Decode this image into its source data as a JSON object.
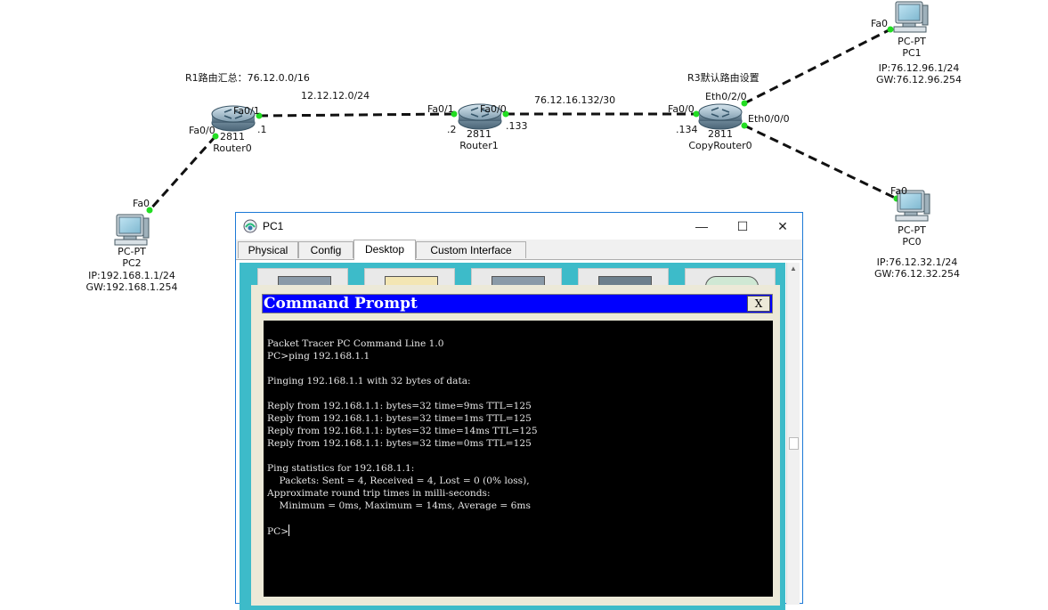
{
  "topology": {
    "devices": [
      {
        "id": "router0",
        "model": "2811",
        "name": "Router0"
      },
      {
        "id": "router1",
        "model": "2811",
        "name": "Router1"
      },
      {
        "id": "copyrouter0",
        "model": "2811",
        "name": "CopyRouter0"
      },
      {
        "id": "pc2",
        "type": "PC-PT",
        "name": "PC2",
        "ip": "IP:192.168.1.1/24",
        "gw": "GW:192.168.1.254"
      },
      {
        "id": "pc1",
        "type": "PC-PT",
        "name": "PC1",
        "ip": "IP:76.12.96.1/24",
        "gw": "GW:76.12.96.254"
      },
      {
        "id": "pc0",
        "type": "PC-PT",
        "name": "PC0",
        "ip": "IP:76.12.32.1/24",
        "gw": "GW:76.12.32.254"
      }
    ],
    "notes": {
      "r1_summary": "R1路由汇总：76.12.0.0/16",
      "r3_default": "R3默认路由设置"
    },
    "networks": {
      "r0_r1": "12.12.12.0/24",
      "r1_r3": "76.12.16.132/30"
    },
    "ports": {
      "r0_fa01": "Fa0/1",
      "r0_fa00": "Fa0/0",
      "r0_dot1": ".1",
      "r1_fa01": "Fa0/1",
      "r1_fa00": "Fa0/0",
      "r1_dot2": ".2",
      "r1_dot133": ".133",
      "r3_fa00": "Fa0/0",
      "r3_eth020": "Eth0/2/0",
      "r3_eth000": "Eth0/0/0",
      "r3_dot134": ".134",
      "pc2_fa0": "Fa0",
      "pc1_fa0": "Fa0",
      "pc0_fa0": "Fa0"
    },
    "link_colors": {
      "cable": "#111111",
      "port_up": "#22dd22"
    }
  },
  "window": {
    "title": "PC1",
    "controls": {
      "minimize": "—",
      "maximize": "☐",
      "close": "✕"
    },
    "tabs": [
      "Physical",
      "Config",
      "Desktop",
      "Custom Interface"
    ],
    "active_tab": "Desktop",
    "colors": {
      "border": "#1c79d6",
      "desktop_bg": "#3dbbc9"
    }
  },
  "command_prompt": {
    "title": "Command Prompt",
    "close_label": "X",
    "title_color": "#0000ff",
    "lines": [
      "Packet Tracer PC Command Line 1.0",
      "PC>ping 192.168.1.1",
      "",
      "Pinging 192.168.1.1 with 32 bytes of data:",
      "",
      "Reply from 192.168.1.1: bytes=32 time=9ms TTL=125",
      "Reply from 192.168.1.1: bytes=32 time=1ms TTL=125",
      "Reply from 192.168.1.1: bytes=32 time=14ms TTL=125",
      "Reply from 192.168.1.1: bytes=32 time=0ms TTL=125",
      "",
      "Ping statistics for 192.168.1.1:",
      "    Packets: Sent = 4, Received = 4, Lost = 0 (0% loss),",
      "Approximate round trip times in milli-seconds:",
      "    Minimum = 0ms, Maximum = 14ms, Average = 6ms",
      ""
    ],
    "prompt": "PC>"
  }
}
